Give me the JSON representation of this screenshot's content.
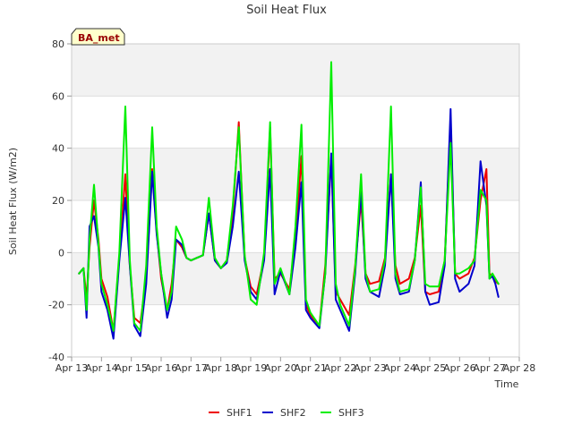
{
  "chart_data": {
    "type": "line",
    "title": "Soil Heat Flux",
    "xlabel": "Time",
    "ylabel": "Soil Heat Flux (W/m2)",
    "badge": "BA_met",
    "xlim": [
      13,
      28
    ],
    "ylim": [
      -40,
      80
    ],
    "x_tick_values": [
      13,
      14,
      15,
      16,
      17,
      18,
      19,
      20,
      21,
      22,
      23,
      24,
      25,
      26,
      27,
      28
    ],
    "x_tick_labels": [
      "Apr 13",
      "Apr 14",
      "Apr 15",
      "Apr 16",
      "Apr 17",
      "Apr 18",
      "Apr 19",
      "Apr 20",
      "Apr 21",
      "Apr 22",
      "Apr 23",
      "Apr 24",
      "Apr 25",
      "Apr 26",
      "Apr 27",
      "Apr 28"
    ],
    "y_ticks": [
      -40,
      -20,
      0,
      20,
      40,
      60,
      80
    ],
    "grid": true,
    "legend_position": "bottom",
    "series": [
      {
        "name": "SHF1",
        "color": "#ee0000",
        "x": [
          13.25,
          13.4,
          13.5,
          13.6,
          13.75,
          13.9,
          14.0,
          14.2,
          14.4,
          14.6,
          14.8,
          14.95,
          15.1,
          15.3,
          15.5,
          15.7,
          15.85,
          16.0,
          16.2,
          16.35,
          16.5,
          16.7,
          16.85,
          17.0,
          17.2,
          17.4,
          17.6,
          17.8,
          18.0,
          18.2,
          18.4,
          18.6,
          18.8,
          19.0,
          19.2,
          19.45,
          19.65,
          19.8,
          20.0,
          20.3,
          20.5,
          20.7,
          20.85,
          21.0,
          21.3,
          21.5,
          21.7,
          21.85,
          22.0,
          22.3,
          22.5,
          22.7,
          22.85,
          23.0,
          23.3,
          23.5,
          23.7,
          23.85,
          24.0,
          24.3,
          24.5,
          24.7,
          24.85,
          25.0,
          25.3,
          25.5,
          25.7,
          25.85,
          26.0,
          26.3,
          26.5,
          26.7,
          26.9,
          27.0,
          27.1,
          27.2,
          27.3
        ],
        "y": [
          -8,
          -6,
          -18,
          2,
          20,
          5,
          -10,
          -17,
          -30,
          -2,
          30,
          -5,
          -25,
          -27,
          -10,
          32,
          8,
          -10,
          -22,
          -12,
          5,
          2,
          -2,
          -3,
          -2,
          -1,
          15,
          -3,
          -6,
          -3,
          15,
          50,
          -2,
          -13,
          -16,
          -2,
          48,
          -10,
          -8,
          -14,
          5,
          37,
          -20,
          -24,
          -28,
          -5,
          37,
          -15,
          -18,
          -24,
          -5,
          20,
          -8,
          -12,
          -11,
          -2,
          30,
          -5,
          -12,
          -10,
          -2,
          18,
          -15,
          -16,
          -15,
          -3,
          50,
          -8,
          -10,
          -8,
          -2,
          20,
          32,
          -8,
          -9,
          -11,
          -12
        ]
      },
      {
        "name": "SHF2",
        "color": "#0000cc",
        "x": [
          13.25,
          13.4,
          13.5,
          13.6,
          13.75,
          13.9,
          14.0,
          14.2,
          14.4,
          14.6,
          14.8,
          14.95,
          15.1,
          15.3,
          15.5,
          15.7,
          15.85,
          16.0,
          16.2,
          16.35,
          16.5,
          16.7,
          16.85,
          17.0,
          17.2,
          17.4,
          17.6,
          17.8,
          18.0,
          18.2,
          18.4,
          18.6,
          18.8,
          19.0,
          19.2,
          19.45,
          19.65,
          19.8,
          20.0,
          20.3,
          20.5,
          20.7,
          20.85,
          21.0,
          21.3,
          21.5,
          21.7,
          21.85,
          22.0,
          22.3,
          22.5,
          22.7,
          22.85,
          23.0,
          23.3,
          23.5,
          23.7,
          23.85,
          24.0,
          24.3,
          24.5,
          24.7,
          24.85,
          25.0,
          25.3,
          25.5,
          25.7,
          25.85,
          26.0,
          26.3,
          26.5,
          26.7,
          26.9,
          27.0,
          27.1,
          27.2,
          27.3
        ],
        "y": [
          -8,
          -6,
          -25,
          10,
          14,
          2,
          -15,
          -22,
          -33,
          -3,
          21,
          -5,
          -28,
          -32,
          -12,
          31,
          7,
          -8,
          -25,
          -18,
          5,
          3,
          -2,
          -3,
          -2,
          -1,
          15,
          -3,
          -6,
          -4,
          10,
          31,
          -3,
          -15,
          -18,
          -3,
          32,
          -16,
          -7,
          -16,
          2,
          27,
          -22,
          -25,
          -29,
          -8,
          38,
          -18,
          -22,
          -30,
          -8,
          24,
          -10,
          -15,
          -17,
          -5,
          30,
          -10,
          -16,
          -15,
          -3,
          27,
          -15,
          -20,
          -19,
          -5,
          55,
          -10,
          -15,
          -12,
          -5,
          35,
          18,
          -10,
          -9,
          -12,
          -17
        ]
      },
      {
        "name": "SHF3",
        "color": "#00ee00",
        "x": [
          13.25,
          13.4,
          13.5,
          13.6,
          13.75,
          13.9,
          14.0,
          14.2,
          14.4,
          14.6,
          14.8,
          14.95,
          15.1,
          15.3,
          15.5,
          15.7,
          15.85,
          16.0,
          16.2,
          16.35,
          16.5,
          16.7,
          16.85,
          17.0,
          17.2,
          17.4,
          17.6,
          17.8,
          18.0,
          18.2,
          18.4,
          18.6,
          18.8,
          19.0,
          19.2,
          19.45,
          19.65,
          19.8,
          20.0,
          20.3,
          20.5,
          20.7,
          20.85,
          21.0,
          21.3,
          21.5,
          21.7,
          21.85,
          22.0,
          22.3,
          22.5,
          22.7,
          22.85,
          23.0,
          23.3,
          23.5,
          23.7,
          23.85,
          24.0,
          24.3,
          24.5,
          24.7,
          24.85,
          25.0,
          25.3,
          25.5,
          25.7,
          25.85,
          26.0,
          26.3,
          26.5,
          26.7,
          26.9,
          27.0,
          27.1,
          27.2,
          27.3
        ],
        "y": [
          -8,
          -6,
          -22,
          5,
          26,
          3,
          -12,
          -20,
          -30,
          0,
          56,
          -3,
          -27,
          -30,
          -5,
          48,
          10,
          -8,
          -22,
          -15,
          10,
          5,
          -2,
          -3,
          -2,
          -1,
          21,
          -2,
          -6,
          -3,
          18,
          48,
          -1,
          -18,
          -20,
          0,
          50,
          -12,
          -6,
          -16,
          10,
          49,
          -18,
          -23,
          -28,
          -8,
          73,
          -12,
          -20,
          -28,
          -6,
          30,
          -8,
          -15,
          -14,
          -3,
          56,
          -8,
          -15,
          -14,
          -3,
          25,
          -12,
          -13,
          -13,
          -3,
          42,
          -8,
          -8,
          -6,
          -3,
          24,
          20,
          -10,
          -8,
          -10,
          -12
        ]
      }
    ]
  }
}
